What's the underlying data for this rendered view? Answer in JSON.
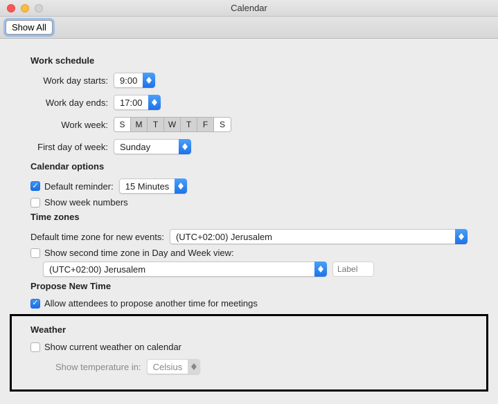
{
  "titlebar": {
    "title": "Calendar"
  },
  "toolbar": {
    "show_all": "Show All"
  },
  "work_schedule": {
    "title": "Work schedule",
    "starts_label": "Work day starts:",
    "starts_value": "9:00",
    "ends_label": "Work day ends:",
    "ends_value": "17:00",
    "week_label": "Work week:",
    "days": [
      "S",
      "M",
      "T",
      "W",
      "T",
      "F",
      "S"
    ],
    "selected": [
      false,
      true,
      true,
      true,
      true,
      true,
      false
    ],
    "first_day_label": "First day of week:",
    "first_day_value": "Sunday"
  },
  "calendar_options": {
    "title": "Calendar options",
    "default_reminder_label": "Default reminder:",
    "default_reminder_value": "15 Minutes",
    "default_reminder_checked": true,
    "week_numbers_label": "Show week numbers",
    "week_numbers_checked": false
  },
  "time_zones": {
    "title": "Time zones",
    "default_tz_label": "Default time zone for new events:",
    "default_tz_value": "(UTC+02:00) Jerusalem",
    "second_tz_label": "Show second time zone in Day and Week view:",
    "second_tz_checked": false,
    "second_tz_value": "(UTC+02:00) Jerusalem",
    "label_placeholder": "Label"
  },
  "propose": {
    "title": "Propose New Time",
    "allow_label": "Allow attendees to propose another time for meetings",
    "allow_checked": true
  },
  "weather": {
    "title": "Weather",
    "show_label": "Show current weather on calendar",
    "show_checked": false,
    "temp_label": "Show temperature in:",
    "temp_value": "Celsius"
  }
}
